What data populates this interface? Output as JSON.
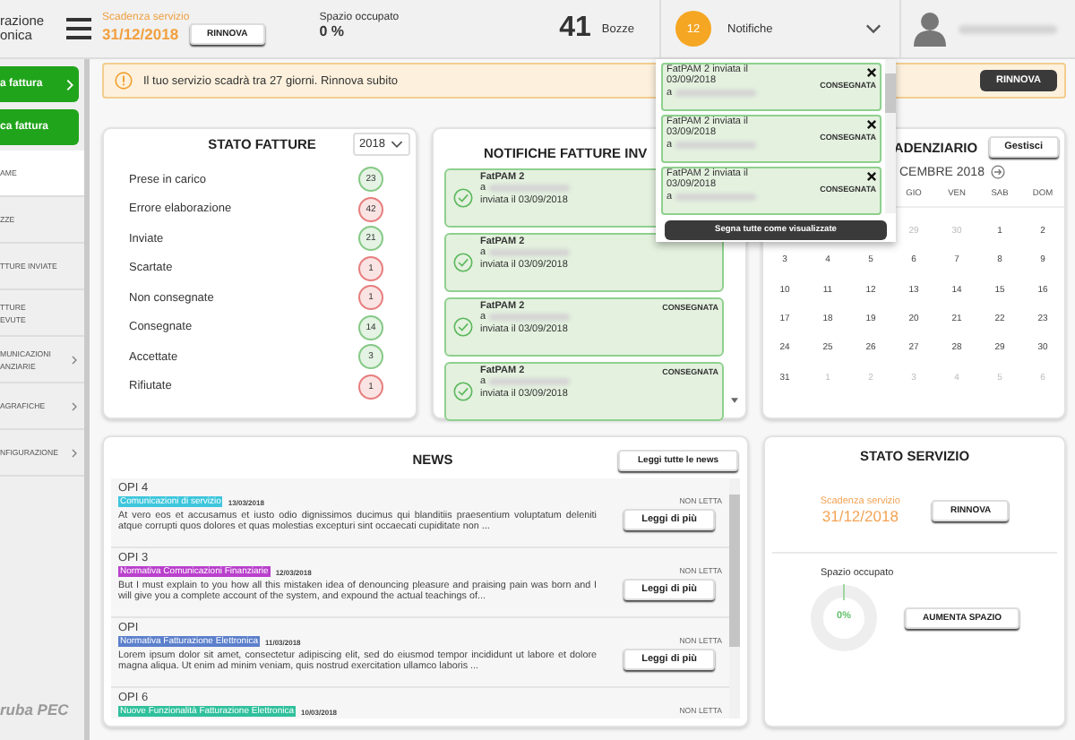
{
  "topbar": {
    "logo_lines": [
      "razione",
      "onica"
    ],
    "expiry_label": "Scadenza servizio",
    "expiry_date": "31/12/2018",
    "renew_button": "RINNOVA",
    "storage_label": "Spazio occupato",
    "storage_value": "0 %",
    "drafts_count": "41",
    "drafts_label": "Bozze",
    "notifications_count": "12",
    "notifications_label": "Notifiche"
  },
  "notifications_dropdown": {
    "items": [
      {
        "text": "FatPAM 2 inviata il",
        "date": "03/09/2018",
        "to": "a",
        "status": "CONSEGNATA"
      },
      {
        "text": "FatPAM 2 inviata il",
        "date": "03/09/2018",
        "to": "a",
        "status": "CONSEGNATA"
      },
      {
        "text": "FatPAM 2 inviata il",
        "date": "03/09/2018",
        "to": "a",
        "status": "CONSEGNATA"
      }
    ],
    "mark_all_button": "Segna tutte come visualizzate"
  },
  "sidebar": {
    "buttons": [
      {
        "label": "a fattura",
        "chevron": true
      },
      {
        "label": "ca fattura",
        "chevron": false
      }
    ],
    "items": [
      {
        "lines": [
          "AME"
        ],
        "selected": true,
        "chevron": false
      },
      {
        "lines": [
          "ZZE"
        ],
        "selected": false,
        "chevron": false
      },
      {
        "lines": [
          "TTURE INVIATE"
        ],
        "selected": false,
        "chevron": false
      },
      {
        "lines": [
          "TTURE",
          "EVUTE"
        ],
        "selected": false,
        "chevron": false
      },
      {
        "lines": [
          "MUNICAZIONI",
          "ANZIARIE"
        ],
        "selected": false,
        "chevron": true
      },
      {
        "lines": [
          "AGRAFICHE"
        ],
        "selected": false,
        "chevron": true
      },
      {
        "lines": [
          "NFIGURAZIONE"
        ],
        "selected": false,
        "chevron": true
      }
    ],
    "footer": "ruba PEC"
  },
  "alert": {
    "text": "Il tuo servizio scadrà tra 27 giorni. Rinnova subito",
    "button": "RINNOVA"
  },
  "invoice_status": {
    "title": "STATO FATTURE",
    "year": "2018",
    "rows": [
      {
        "label": "Prese in carico",
        "count": "23",
        "color": "#86c986"
      },
      {
        "label": "Errore elaborazione",
        "count": "42",
        "color": "#e77e7e"
      },
      {
        "label": "Inviate",
        "count": "21",
        "color": "#86c986"
      },
      {
        "label": "Scartate",
        "count": "1",
        "color": "#e77e7e"
      },
      {
        "label": "Non consegnate",
        "count": "1",
        "color": "#e77e7e"
      },
      {
        "label": "Consegnate",
        "count": "14",
        "color": "#86c986"
      },
      {
        "label": "Accettate",
        "count": "3",
        "color": "#86c986"
      },
      {
        "label": "Rifiutate",
        "count": "1",
        "color": "#e77e7e"
      }
    ]
  },
  "sent_notifications": {
    "title": "NOTIFICHE FATTURE INV",
    "items": [
      {
        "name": "FatPAM 2",
        "to": "a",
        "sent": "inviata il 03/09/2018"
      },
      {
        "name": "FatPAM 2",
        "to": "a",
        "sent": "inviata il 03/09/2018"
      },
      {
        "name": "FatPAM 2",
        "to": "a",
        "sent": "inviata il 03/09/2018",
        "status": "CONSEGNATA"
      },
      {
        "name": "FatPAM 2",
        "to": "a",
        "sent": "inviata il 03/09/2018",
        "status": "CONSEGNATA"
      }
    ]
  },
  "calendar": {
    "title": "ADENZIARIO",
    "manage_button": "Gestisci",
    "month": "CEMBRE 2018",
    "weekdays": [
      "GIO",
      "VEN",
      "SAB",
      "DOM"
    ],
    "weeks": [
      [
        {
          "day": "29",
          "muted": true
        },
        {
          "day": "30",
          "muted": true
        },
        {
          "day": "1",
          "muted": false
        },
        {
          "day": "2",
          "muted": false
        }
      ],
      [
        {
          "day": "3",
          "muted": false
        },
        {
          "day": "4",
          "muted": false
        },
        {
          "day": "5",
          "muted": false
        },
        {
          "day": "6",
          "muted": false
        },
        {
          "day": "7",
          "muted": false
        },
        {
          "day": "8",
          "muted": false
        },
        {
          "day": "9",
          "muted": false
        }
      ],
      [
        {
          "day": "10",
          "muted": false
        },
        {
          "day": "11",
          "muted": false
        },
        {
          "day": "12",
          "muted": false
        },
        {
          "day": "13",
          "muted": false
        },
        {
          "day": "14",
          "muted": false
        },
        {
          "day": "15",
          "muted": false
        },
        {
          "day": "16",
          "muted": false
        }
      ],
      [
        {
          "day": "17",
          "muted": false
        },
        {
          "day": "18",
          "muted": false
        },
        {
          "day": "19",
          "muted": false
        },
        {
          "day": "20",
          "muted": false
        },
        {
          "day": "21",
          "muted": false
        },
        {
          "day": "22",
          "muted": false
        },
        {
          "day": "23",
          "muted": false
        }
      ],
      [
        {
          "day": "24",
          "muted": false
        },
        {
          "day": "25",
          "muted": false
        },
        {
          "day": "26",
          "muted": false
        },
        {
          "day": "27",
          "muted": false
        },
        {
          "day": "28",
          "muted": false
        },
        {
          "day": "29",
          "muted": false
        },
        {
          "day": "30",
          "muted": false
        }
      ],
      [
        {
          "day": "31",
          "muted": false
        },
        {
          "day": "1",
          "muted": true
        },
        {
          "day": "2",
          "muted": true
        },
        {
          "day": "3",
          "muted": true
        },
        {
          "day": "4",
          "muted": true
        },
        {
          "day": "5",
          "muted": true
        },
        {
          "day": "6",
          "muted": true
        }
      ]
    ]
  },
  "news": {
    "title": "NEWS",
    "all_button": "Leggi tutte le news",
    "items": [
      {
        "title": "OPI 4",
        "tag": "Comunicazioni di servizio",
        "color": "#3ec6dc",
        "date": "13/03/2018",
        "body": "At vero eos et accusamus et iusto odio dignissimos ducimus qui blanditiis praesentium voluptatum deleniti atque corrupti quos dolores et quas molestias excepturi sint occaecati cupiditate non ...",
        "status": "NON LETTA",
        "button": "Leggi di più"
      },
      {
        "title": "OPI 3",
        "tag": "Normativa Comunicazioni Finanziarie",
        "color": "#b940cc",
        "date": "12/03/2018",
        "body": "But I must explain to you how all this mistaken idea of denouncing pleasure and praising pain was born and I will give you a complete account of the system, and expound the actual teachings of...",
        "status": "NON LETTA",
        "button": "Leggi di più"
      },
      {
        "title": "OPI",
        "tag": "Normativa Fatturazione Elettronica",
        "color": "#5b7fcc",
        "date": "11/03/2018",
        "body": "Lorem ipsum dolor sit amet, consectetur adipiscing elit, sed do eiusmod tempor incididunt ut labore et dolore magna aliqua. Ut enim ad minim veniam, quis nostrud exercitation ullamco laboris ...",
        "status": "NON LETTA",
        "button": "Leggi di più"
      },
      {
        "title": "OPI 6",
        "tag": "Nuove Funzionalità Fatturazione Elettronica",
        "color": "#2fc09c",
        "date": "10/03/2018",
        "status": "NON LETTA"
      }
    ]
  },
  "service": {
    "title": "STATO SERVIZIO",
    "expiry_label": "Scadenza servizio",
    "expiry_date": "31/12/2018",
    "renew_button": "RINNOVA",
    "storage_label": "Spazio occupato",
    "storage_value": "0%",
    "level": 0,
    "increase_button": "AUMENTA SPAZIO"
  }
}
